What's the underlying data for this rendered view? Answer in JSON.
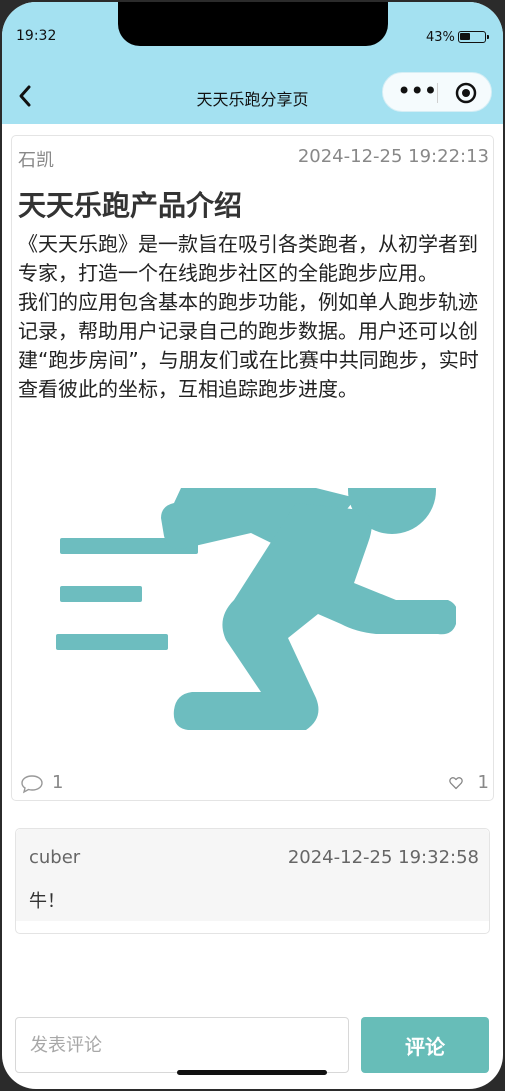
{
  "status_bar": {
    "time": "19:32",
    "battery_percent": "43%",
    "battery_level": 0.43
  },
  "navbar": {
    "title": "天天乐跑分享页",
    "back_icon": "chevron-left-icon",
    "more_icon": "more-dots-icon",
    "close_icon": "target-circle-icon"
  },
  "post": {
    "author": "石凯",
    "time": "2024-12-25 19:22:13",
    "title": "天天乐跑产品介绍",
    "body": "《天天乐跑》是一款旨在吸引各类跑者，从初学者到专家，打造一个在线跑步社区的全能跑步应用。\n我们的应用包含基本的跑步功能，例如单人跑步轨迹记录，帮助用户记录自己的跑步数据。用户还可以创建“跑步房间”，与朋友们或在比赛中共同跑步，实时查看彼此的坐标，互相追踪跑步进度。",
    "image_icon": "runner-icon",
    "comment_count": "1",
    "like_count": "1"
  },
  "comments": [
    {
      "user": "cuber",
      "time": "2024-12-25 19:32:58",
      "text": "牛！"
    }
  ],
  "composer": {
    "placeholder": "发表评论",
    "submit_label": "评论"
  },
  "colors": {
    "header_bg": "#a4e1f1",
    "accent": "#67bdb8"
  }
}
